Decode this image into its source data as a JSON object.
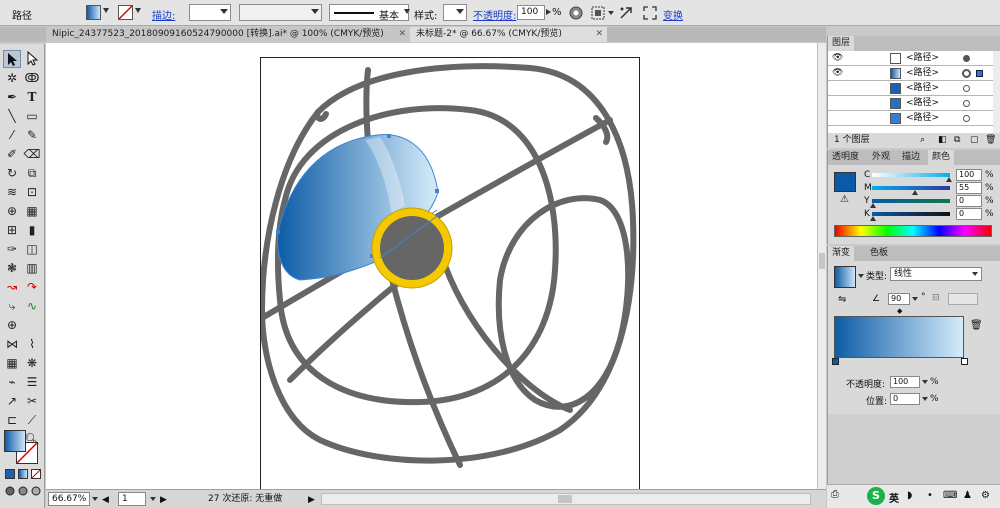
{
  "control_bar": {
    "object_label": "路径",
    "stroke_label": "描边:",
    "stroke_profile": "基本",
    "style_label": "样式:",
    "opacity_label": "不透明度:",
    "opacity_value": "100",
    "opacity_unit": "%",
    "transform_label": "变换"
  },
  "tabs": [
    {
      "label": "Nipic_24377523_20180909160524790000 [转换].ai* @ 100% (CMYK/预览)"
    },
    {
      "label": "未标题-2* @ 66.67% (CMYK/预览)"
    }
  ],
  "status": {
    "zoom": "66.67%",
    "page": "1",
    "message": "27 次还原: 无重做"
  },
  "layers_panel": {
    "title": "图层",
    "rows": [
      {
        "name": "<路径>"
      },
      {
        "name": "<路径>"
      },
      {
        "name": "<路径>"
      },
      {
        "name": "<路径>"
      },
      {
        "name": "<路径>"
      }
    ],
    "footer": "1 个图层"
  },
  "color_panel": {
    "tabs": [
      "透明度",
      "外观",
      "描边",
      "颜色"
    ],
    "channels": [
      {
        "label": "C",
        "value": "100"
      },
      {
        "label": "M",
        "value": "55"
      },
      {
        "label": "Y",
        "value": "0"
      },
      {
        "label": "K",
        "value": "0"
      }
    ],
    "fill_color": "#0a5aa8"
  },
  "gradient_panel": {
    "tabs": [
      "渐变",
      "色板"
    ],
    "type_label": "类型:",
    "type_value": "线性",
    "angle": "90",
    "angle_unit": "°",
    "opacity_label": "不透明度:",
    "opacity_value": "100",
    "opacity_unit": "%",
    "position_label": "位置:",
    "position_value": "0",
    "position_unit": "%",
    "stop_start": "#0d5ca6",
    "stop_end": "#d6ecfa"
  },
  "taskbar": {
    "ime_label": "英"
  }
}
